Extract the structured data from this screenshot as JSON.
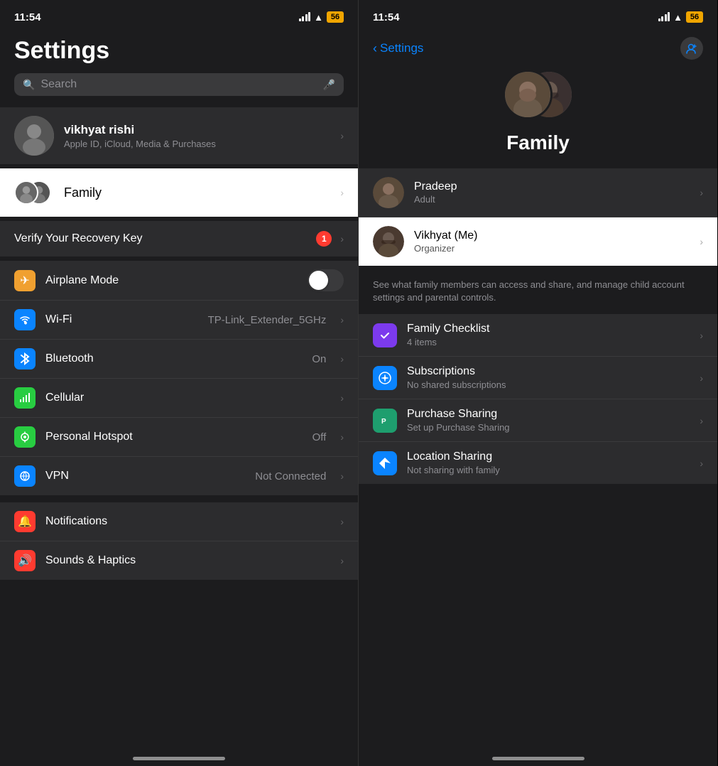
{
  "left": {
    "status": {
      "time": "11:54",
      "battery": "56"
    },
    "title": "Settings",
    "search": {
      "placeholder": "Search"
    },
    "account": {
      "name": "vikhyat rishi",
      "subtitle": "Apple ID, iCloud, Media & Purchases"
    },
    "family_row": {
      "label": "Family"
    },
    "recovery": {
      "label": "Verify Your Recovery Key",
      "badge": "1"
    },
    "settings_items": [
      {
        "name": "Airplane Mode",
        "icon_bg": "#f0a030",
        "icon": "✈",
        "value": "",
        "type": "toggle"
      },
      {
        "name": "Wi-Fi",
        "icon_bg": "#0a84ff",
        "icon": "📶",
        "value": "TP-Link_Extender_5GHz",
        "type": "chevron"
      },
      {
        "name": "Bluetooth",
        "icon_bg": "#0a84ff",
        "icon": "⬡",
        "value": "On",
        "type": "chevron"
      },
      {
        "name": "Cellular",
        "icon_bg": "#28cd41",
        "icon": "◎",
        "value": "",
        "type": "chevron"
      },
      {
        "name": "Personal Hotspot",
        "icon_bg": "#28cd41",
        "icon": "∞",
        "value": "Off",
        "type": "chevron"
      },
      {
        "name": "VPN",
        "icon_bg": "#0a84ff",
        "icon": "🌐",
        "value": "Not Connected",
        "type": "chevron"
      }
    ],
    "bottom_items": [
      {
        "name": "Notifications",
        "icon_bg": "#ff3b30",
        "icon": "🔔"
      },
      {
        "name": "Sounds & Haptics",
        "icon_bg": "#ff3b30",
        "icon": "🔊"
      }
    ]
  },
  "right": {
    "status": {
      "time": "11:54",
      "battery": "56"
    },
    "nav": {
      "back_label": "Settings"
    },
    "header": {
      "title": "Family"
    },
    "members": [
      {
        "name": "Pradeep",
        "role": "Adult",
        "highlighted": false
      },
      {
        "name": "Vikhyat (Me)",
        "role": "Organizer",
        "highlighted": true
      }
    ],
    "description": "See what family members can access and share, and manage child account settings and parental controls.",
    "features": [
      {
        "name": "Family Checklist",
        "subtitle": "4 items",
        "icon_bg": "#7c3aed",
        "icon": "✓"
      },
      {
        "name": "Subscriptions",
        "subtitle": "No shared subscriptions",
        "icon_bg": "#0a84ff",
        "icon": "⊕"
      },
      {
        "name": "Purchase Sharing",
        "subtitle": "Set up Purchase Sharing",
        "icon_bg": "#1e9e6e",
        "icon": "P"
      },
      {
        "name": "Location Sharing",
        "subtitle": "Not sharing with family",
        "icon_bg": "#0a84ff",
        "icon": "➤"
      }
    ]
  }
}
